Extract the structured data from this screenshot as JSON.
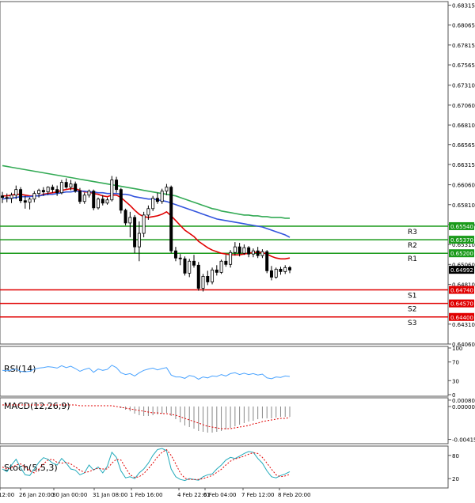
{
  "chart_data": [
    {
      "type": "candlestick",
      "panel": "price",
      "ylim": [
        0.6406,
        0.6836
      ],
      "y_ticks": [
        "0.68315",
        "0.68065",
        "0.67815",
        "0.67565",
        "0.67310",
        "0.67060",
        "0.66810",
        "0.66565",
        "0.66315",
        "0.66060",
        "0.65810",
        "0.65560",
        "0.65310",
        "0.65060",
        "0.64810",
        "0.64310",
        "0.64060"
      ],
      "last_price": "0.64992",
      "levels": [
        {
          "name": "R3",
          "value": 0.6554,
          "label": "0.65540",
          "color": "#1a9a1a"
        },
        {
          "name": "R2",
          "value": 0.6537,
          "label": "0.65370",
          "color": "#1a9a1a"
        },
        {
          "name": "R1",
          "value": 0.652,
          "label": "0.65200",
          "color": "#1a9a1a"
        },
        {
          "name": "S1",
          "value": 0.6474,
          "label": "0.64740",
          "color": "#e00000"
        },
        {
          "name": "S2",
          "value": 0.6457,
          "label": "0.64570",
          "color": "#e00000"
        },
        {
          "name": "S3",
          "value": 0.644,
          "label": "0.64400",
          "color": "#e00000"
        }
      ],
      "candles": [
        [
          0.6592,
          0.6597,
          0.6583,
          0.659
        ],
        [
          0.659,
          0.6595,
          0.6584,
          0.6589
        ],
        [
          0.6589,
          0.6596,
          0.6583,
          0.6593
        ],
        [
          0.6593,
          0.6605,
          0.6588,
          0.66
        ],
        [
          0.66,
          0.6603,
          0.6583,
          0.6586
        ],
        [
          0.6586,
          0.6592,
          0.6576,
          0.6584
        ],
        [
          0.6584,
          0.659,
          0.6575,
          0.6588
        ],
        [
          0.6588,
          0.6598,
          0.6584,
          0.6595
        ],
        [
          0.6595,
          0.6601,
          0.659,
          0.6599
        ],
        [
          0.6599,
          0.6603,
          0.6592,
          0.6597
        ],
        [
          0.6597,
          0.6604,
          0.6593,
          0.6603
        ],
        [
          0.6603,
          0.6606,
          0.6596,
          0.66
        ],
        [
          0.66,
          0.6605,
          0.6592,
          0.6596
        ],
        [
          0.6596,
          0.6612,
          0.6594,
          0.6609
        ],
        [
          0.6609,
          0.6614,
          0.6601,
          0.6603
        ],
        [
          0.6603,
          0.6612,
          0.6599,
          0.6607
        ],
        [
          0.6607,
          0.661,
          0.6596,
          0.6598
        ],
        [
          0.6598,
          0.6602,
          0.6582,
          0.6585
        ],
        [
          0.6585,
          0.6596,
          0.6582,
          0.6593
        ],
        [
          0.6593,
          0.66,
          0.659,
          0.6598
        ],
        [
          0.6598,
          0.66,
          0.6574,
          0.6577
        ],
        [
          0.6577,
          0.659,
          0.6575,
          0.6588
        ],
        [
          0.6588,
          0.6593,
          0.658,
          0.6583
        ],
        [
          0.6583,
          0.659,
          0.6581,
          0.6587
        ],
        [
          0.6587,
          0.6617,
          0.6585,
          0.6612
        ],
        [
          0.6612,
          0.6616,
          0.6596,
          0.66
        ],
        [
          0.66,
          0.6602,
          0.657,
          0.6574
        ],
        [
          0.6574,
          0.6576,
          0.6555,
          0.6558
        ],
        [
          0.6558,
          0.6572,
          0.654,
          0.6565
        ],
        [
          0.6565,
          0.6568,
          0.652,
          0.6528
        ],
        [
          0.6528,
          0.656,
          0.651,
          0.6545
        ],
        [
          0.6545,
          0.6572,
          0.654,
          0.6568
        ],
        [
          0.6568,
          0.658,
          0.6562,
          0.6576
        ],
        [
          0.6576,
          0.6592,
          0.6573,
          0.6589
        ],
        [
          0.6589,
          0.6596,
          0.6582,
          0.6585
        ],
        [
          0.6585,
          0.6601,
          0.6582,
          0.6598
        ],
        [
          0.6598,
          0.6607,
          0.6593,
          0.6603
        ],
        [
          0.6603,
          0.6605,
          0.652,
          0.6523
        ],
        [
          0.6523,
          0.6528,
          0.651,
          0.6514
        ],
        [
          0.6514,
          0.6519,
          0.6505,
          0.6513
        ],
        [
          0.6513,
          0.6516,
          0.6492,
          0.6495
        ],
        [
          0.6495,
          0.6513,
          0.649,
          0.651
        ],
        [
          0.651,
          0.6518,
          0.6502,
          0.6505
        ],
        [
          0.6505,
          0.6509,
          0.6473,
          0.6476
        ],
        [
          0.6476,
          0.6494,
          0.6472,
          0.6491
        ],
        [
          0.6491,
          0.6498,
          0.648,
          0.6484
        ],
        [
          0.6484,
          0.6502,
          0.6481,
          0.6499
        ],
        [
          0.6499,
          0.6505,
          0.6492,
          0.6496
        ],
        [
          0.6496,
          0.6512,
          0.6494,
          0.651
        ],
        [
          0.651,
          0.6518,
          0.6503,
          0.6506
        ],
        [
          0.6506,
          0.6524,
          0.6502,
          0.6521
        ],
        [
          0.6521,
          0.6534,
          0.6517,
          0.6528
        ],
        [
          0.6528,
          0.6533,
          0.6516,
          0.652
        ],
        [
          0.652,
          0.6531,
          0.6518,
          0.6527
        ],
        [
          0.6527,
          0.6529,
          0.6515,
          0.6519
        ],
        [
          0.6519,
          0.6526,
          0.6515,
          0.6523
        ],
        [
          0.6523,
          0.6528,
          0.6514,
          0.6517
        ],
        [
          0.6517,
          0.6525,
          0.6514,
          0.6522
        ],
        [
          0.6522,
          0.6524,
          0.6495,
          0.6498
        ],
        [
          0.6498,
          0.6504,
          0.6486,
          0.649
        ],
        [
          0.649,
          0.6502,
          0.6488,
          0.65
        ],
        [
          0.65,
          0.6503,
          0.6493,
          0.6497
        ],
        [
          0.6497,
          0.6505,
          0.6494,
          0.6502
        ],
        [
          0.6502,
          0.6504,
          0.6495,
          0.6499
        ]
      ],
      "series": [
        {
          "name": "",
          "color": "#e00000",
          "values": [
            0.6592,
            0.6592,
            0.6593,
            0.6594,
            0.6594,
            0.6593,
            0.6592,
            0.6592,
            0.6592,
            0.6594,
            0.6595,
            0.6596,
            0.6597,
            0.6599,
            0.66,
            0.6601,
            0.6601,
            0.6599,
            0.6597,
            0.6597,
            0.6595,
            0.6594,
            0.6592,
            0.6591,
            0.6593,
            0.6593,
            0.659,
            0.6585,
            0.658,
            0.6574,
            0.6569,
            0.6566,
            0.6565,
            0.6566,
            0.6567,
            0.6569,
            0.6572,
            0.6567,
            0.6561,
            0.6555,
            0.6549,
            0.6545,
            0.6541,
            0.6535,
            0.6531,
            0.6527,
            0.6524,
            0.6522,
            0.652,
            0.6519,
            0.6518,
            0.6518,
            0.6518,
            0.6519,
            0.652,
            0.6521,
            0.6521,
            0.6521,
            0.6519,
            0.6516,
            0.6514,
            0.6513,
            0.6513,
            0.6514
          ]
        },
        {
          "name": "",
          "color": "#3355dd",
          "values": [
            0.6588,
            0.6589,
            0.6589,
            0.659,
            0.6591,
            0.6591,
            0.6591,
            0.6592,
            0.6592,
            0.6593,
            0.6594,
            0.6594,
            0.6595,
            0.6596,
            0.6597,
            0.6597,
            0.6598,
            0.6598,
            0.6598,
            0.6597,
            0.6597,
            0.6596,
            0.6596,
            0.6595,
            0.6595,
            0.6595,
            0.6594,
            0.6594,
            0.6593,
            0.6591,
            0.659,
            0.6589,
            0.6588,
            0.6588,
            0.6587,
            0.6586,
            0.6585,
            0.6583,
            0.6581,
            0.6579,
            0.6577,
            0.6575,
            0.6573,
            0.6571,
            0.6569,
            0.6567,
            0.6565,
            0.6563,
            0.6562,
            0.6561,
            0.656,
            0.6559,
            0.6558,
            0.6557,
            0.6556,
            0.6555,
            0.6554,
            0.6553,
            0.6551,
            0.6549,
            0.6547,
            0.6545,
            0.6543,
            0.654
          ]
        },
        {
          "name": "",
          "color": "#33aa55",
          "values": [
            0.663,
            0.6629,
            0.6628,
            0.6627,
            0.6626,
            0.6625,
            0.6624,
            0.6623,
            0.6622,
            0.6621,
            0.662,
            0.6619,
            0.6618,
            0.6617,
            0.6616,
            0.6615,
            0.6614,
            0.6613,
            0.6612,
            0.6611,
            0.661,
            0.6609,
            0.6608,
            0.6607,
            0.6606,
            0.6605,
            0.6604,
            0.6603,
            0.6602,
            0.6601,
            0.66,
            0.6599,
            0.6598,
            0.6597,
            0.6596,
            0.6595,
            0.6594,
            0.6593,
            0.6592,
            0.659,
            0.6588,
            0.6586,
            0.6584,
            0.6582,
            0.658,
            0.6578,
            0.6576,
            0.6575,
            0.6573,
            0.6572,
            0.6571,
            0.657,
            0.6569,
            0.6568,
            0.6568,
            0.6567,
            0.6567,
            0.6566,
            0.6566,
            0.6565,
            0.6565,
            0.6565,
            0.6564,
            0.6564
          ]
        }
      ]
    },
    {
      "type": "line",
      "panel": "rsi",
      "title": "RSI(14)",
      "ylim": [
        0,
        100
      ],
      "y_ticks": [
        "100",
        "70",
        "30",
        "0"
      ],
      "series": [
        {
          "name": "RSI(14)",
          "color": "#4aa3ff",
          "values": [
            52,
            51,
            53,
            55,
            50,
            49,
            50,
            55,
            57,
            58,
            60,
            59,
            57,
            62,
            58,
            61,
            56,
            50,
            54,
            57,
            48,
            55,
            52,
            54,
            63,
            58,
            47,
            43,
            45,
            40,
            47,
            52,
            55,
            57,
            53,
            56,
            58,
            42,
            38,
            38,
            35,
            41,
            39,
            33,
            38,
            36,
            40,
            39,
            43,
            40,
            45,
            47,
            43,
            46,
            43,
            45,
            42,
            44,
            36,
            34,
            38,
            37,
            40,
            39
          ]
        }
      ]
    },
    {
      "type": "bar",
      "panel": "macd",
      "title": "MACD(12,26,9)",
      "y_ticks": [
        "0.000807",
        "0.000000",
        "-0.004154"
      ],
      "ylim": [
        -0.0045,
        0.0009
      ],
      "series": [
        {
          "name": "histogram",
          "color": "#888888",
          "values": [
            0,
            0,
            0,
            0,
            0,
            0,
            0,
            0,
            0,
            0,
            0,
            0,
            0,
            0,
            0,
            0,
            0,
            0,
            0,
            0,
            0,
            0,
            0,
            0,
            0,
            0,
            -0.0002,
            -0.0004,
            -0.0006,
            -0.0009,
            -0.0011,
            -0.0012,
            -0.0012,
            -0.0011,
            -0.001,
            -0.0009,
            -0.0008,
            -0.0012,
            -0.0016,
            -0.002,
            -0.0024,
            -0.0026,
            -0.0028,
            -0.0031,
            -0.0032,
            -0.0033,
            -0.0033,
            -0.0032,
            -0.0031,
            -0.0029,
            -0.0027,
            -0.0025,
            -0.0023,
            -0.0021,
            -0.0019,
            -0.0018,
            -0.0016,
            -0.0015,
            -0.0015,
            -0.0015,
            -0.0014,
            -0.0013,
            -0.0013,
            -0.0013
          ]
        },
        {
          "name": "signal",
          "color": "#e00000",
          "values": [
            0.0002,
            0.0002,
            0.0002,
            0.0002,
            0.0002,
            0.0002,
            0.0002,
            0.0002,
            0.0002,
            0.0002,
            0.0002,
            0.0002,
            0.0002,
            0.0002,
            0.0002,
            0.0002,
            0.0002,
            0.0001,
            0.0001,
            0.0001,
            0.0001,
            0.0001,
            0.0001,
            0.0001,
            0.0001,
            0.0,
            -0.0001,
            -0.0002,
            -0.0003,
            -0.0004,
            -0.0005,
            -0.0006,
            -0.0007,
            -0.0008,
            -0.0008,
            -0.0009,
            -0.0009,
            -0.001,
            -0.0011,
            -0.0013,
            -0.0015,
            -0.0017,
            -0.0019,
            -0.0021,
            -0.0023,
            -0.0025,
            -0.0026,
            -0.0027,
            -0.0028,
            -0.0028,
            -0.0028,
            -0.0027,
            -0.0026,
            -0.0025,
            -0.0024,
            -0.0022,
            -0.0021,
            -0.0019,
            -0.0018,
            -0.0017,
            -0.0016,
            -0.0015,
            -0.0015,
            -0.0014
          ]
        }
      ]
    },
    {
      "type": "line",
      "panel": "stoch",
      "title": "Stoch(5,5,3)",
      "ylim": [
        0,
        100
      ],
      "y_ticks": [
        "80",
        "20"
      ],
      "series": [
        {
          "name": "%K",
          "color": "#22aabb",
          "values": [
            45,
            38,
            55,
            70,
            48,
            30,
            28,
            45,
            62,
            74,
            70,
            60,
            55,
            72,
            60,
            45,
            42,
            30,
            35,
            55,
            42,
            50,
            35,
            52,
            88,
            75,
            40,
            22,
            25,
            20,
            35,
            45,
            60,
            80,
            95,
            98,
            92,
            45,
            25,
            18,
            15,
            20,
            18,
            16,
            25,
            30,
            32,
            45,
            55,
            68,
            75,
            72,
            78,
            85,
            90,
            88,
            72,
            60,
            40,
            25,
            22,
            28,
            32,
            38
          ]
        },
        {
          "name": "%D",
          "color": "#e00000",
          "values": [
            50,
            45,
            48,
            55,
            58,
            50,
            40,
            35,
            45,
            58,
            68,
            70,
            62,
            60,
            62,
            58,
            50,
            42,
            36,
            38,
            43,
            47,
            45,
            45,
            60,
            70,
            68,
            48,
            30,
            23,
            25,
            33,
            46,
            60,
            76,
            88,
            95,
            80,
            58,
            35,
            21,
            18,
            18,
            18,
            20,
            24,
            28,
            36,
            44,
            55,
            65,
            71,
            74,
            78,
            83,
            87,
            85,
            75,
            60,
            44,
            30,
            25,
            27,
            31
          ]
        }
      ]
    }
  ],
  "x_labels": [
    "12:00",
    "26 Jan 20:00",
    "30 Jan 00:00",
    "31 Jan 08:00",
    "1 Feb 16:00",
    "4 Feb 22:01",
    "6 Feb 04:00",
    "7 Feb 12:00",
    "8 Feb 20:00"
  ]
}
